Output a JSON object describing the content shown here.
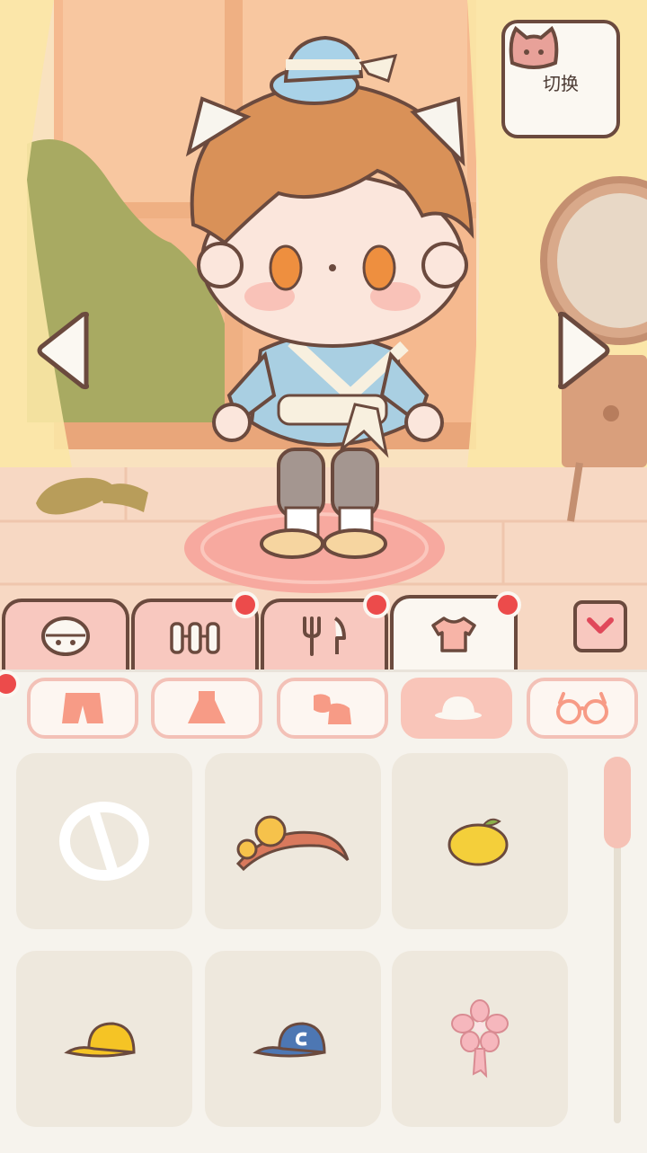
{
  "switch_button": {
    "label": "切换",
    "icon": "cat-face-icon"
  },
  "category_tabs": [
    {
      "id": "face",
      "icon": "face-icon",
      "active": false,
      "badge": false
    },
    {
      "id": "furniture",
      "icon": "fence-icon",
      "active": false,
      "badge": true
    },
    {
      "id": "food",
      "icon": "cutlery-icon",
      "active": false,
      "badge": true
    },
    {
      "id": "clothing",
      "icon": "shirt-icon",
      "active": true,
      "badge": true
    }
  ],
  "sub_tabs": [
    {
      "id": "pants",
      "icon": "shorts-icon",
      "active": false
    },
    {
      "id": "dress",
      "icon": "dress-icon",
      "active": false
    },
    {
      "id": "shoes",
      "icon": "shoes-icon",
      "active": false
    },
    {
      "id": "hats",
      "icon": "hat-icon",
      "active": true
    },
    {
      "id": "glasses",
      "icon": "glasses-icon",
      "active": false
    }
  ],
  "items": [
    {
      "icon": "none-icon"
    },
    {
      "icon": "chick-headband-icon"
    },
    {
      "icon": "lemon-clip-icon"
    },
    {
      "icon": "yellow-cap-icon"
    },
    {
      "icon": "blue-cap-icon"
    },
    {
      "icon": "sakura-pin-icon"
    }
  ],
  "colors": {
    "accent": "#f8c8bf",
    "outline": "#6b4a3e",
    "badge": "#ec4b4b"
  }
}
